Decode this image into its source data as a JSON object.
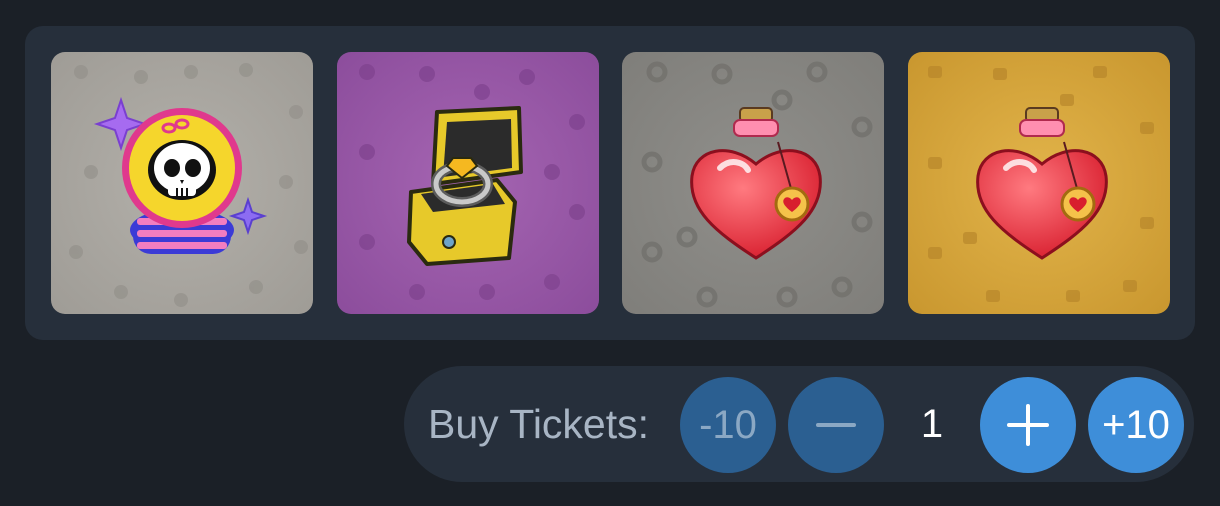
{
  "gifts": [
    {
      "name": "Crystal Ball",
      "icon": "crystal-ball-skull-icon",
      "background": "#a9a6a0"
    },
    {
      "name": "Ring",
      "icon": "ring-box-icon",
      "background": "#9b5ba8"
    },
    {
      "name": "Love Potion",
      "icon": "heart-potion-icon",
      "background": "#8a8a88"
    },
    {
      "name": "Love Potion",
      "icon": "heart-potion-icon",
      "background": "#d9a93e"
    }
  ],
  "tickets": {
    "label": "Buy Tickets:",
    "minus10_label": "-10",
    "minus_icon": "minus-icon",
    "quantity": "1",
    "plus_icon": "plus-icon",
    "plus10_label": "+10"
  },
  "colors": {
    "page_bg": "#1b2027",
    "panel_bg": "#262f3b",
    "accent_blue": "#3e8ed9",
    "muted_blue": "#2b5f91"
  }
}
